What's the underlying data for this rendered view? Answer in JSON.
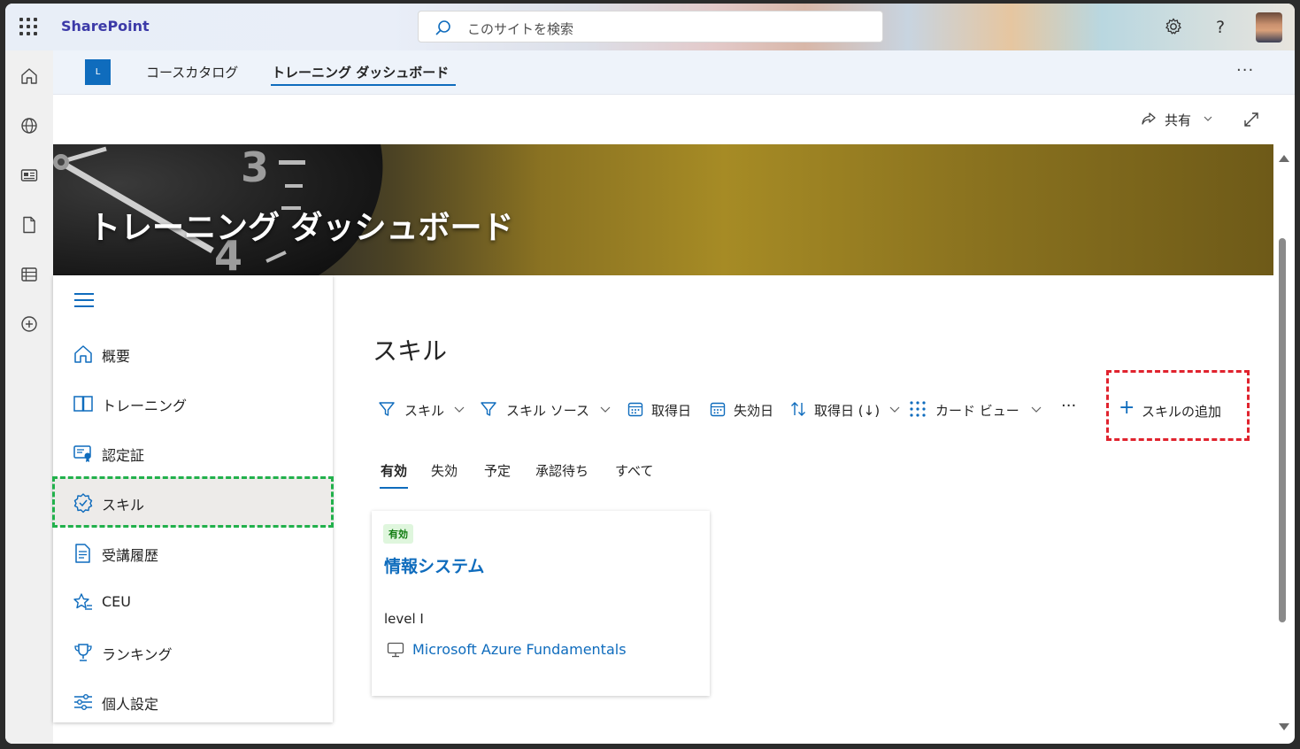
{
  "suite": {
    "app_name": "SharePoint",
    "search_placeholder": "このサイトを検索"
  },
  "site_nav": {
    "logo_letter": "L",
    "links": [
      "コースカタログ",
      "トレーニング ダッシュボード"
    ],
    "active_index": 1
  },
  "commands": {
    "share_label": "共有"
  },
  "banner": {
    "title": "トレーニング ダッシュボード",
    "dial_numbers": [
      "3",
      "4"
    ]
  },
  "left_nav": {
    "items": [
      {
        "label": "概要",
        "icon": "home-icon"
      },
      {
        "label": "トレーニング",
        "icon": "book-icon"
      },
      {
        "label": "認定証",
        "icon": "certificate-icon"
      },
      {
        "label": "スキル",
        "icon": "skill-badge-icon"
      },
      {
        "label": "受講履歴",
        "icon": "document-list-icon"
      },
      {
        "label": "CEU",
        "icon": "star-list-icon"
      },
      {
        "label": "ランキング",
        "icon": "trophy-icon"
      },
      {
        "label": "個人設定",
        "icon": "sliders-icon"
      }
    ],
    "selected_index": 3
  },
  "main": {
    "title": "スキル",
    "toolbar": {
      "filter_skill": "スキル",
      "filter_skill_source": "スキル ソース",
      "acquired_date": "取得日",
      "expiry_date": "失効日",
      "sort": "取得日 (↓)",
      "view": "カード ビュー",
      "add_skill": "スキルの追加"
    },
    "tabs": [
      "有効",
      "失効",
      "予定",
      "承認待ち",
      "すべて"
    ],
    "active_tab": 0,
    "cards": [
      {
        "status": "有効",
        "title": "情報システム",
        "level": "level I",
        "course": "Microsoft Azure Fundamentals"
      }
    ]
  },
  "colors": {
    "accent": "#0f6cbd",
    "brand_text": "#3c3aa8",
    "selected_outline": "#22b14c",
    "highlight_outline": "#e0232e",
    "status_badge_bg": "#dff6dd",
    "status_badge_text": "#107c10"
  }
}
